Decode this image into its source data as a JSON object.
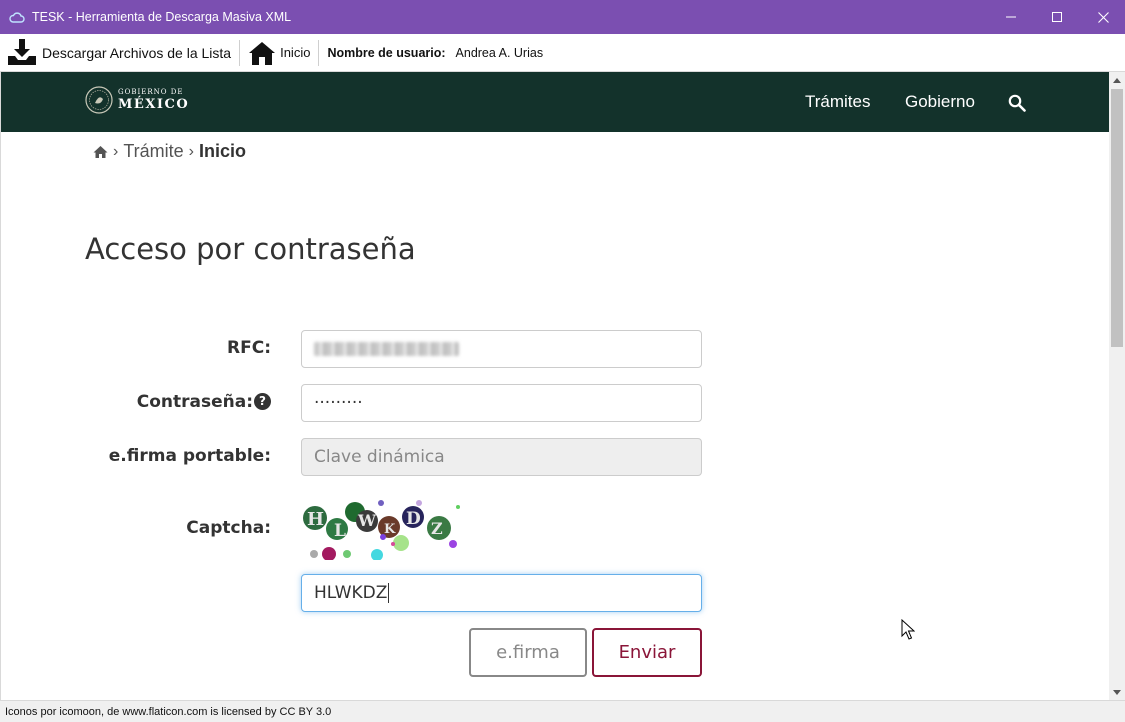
{
  "window": {
    "title": "TESK - Herramienta de Descarga Masiva XML",
    "app_icon": "cloud-icon",
    "controls": [
      "minimize-icon",
      "maximize-icon",
      "close-icon"
    ]
  },
  "toolbar": {
    "download_label": "Descargar Archivos de la Lista",
    "home_label": "Inicio",
    "user_label": "Nombre de usuario:",
    "user_name": "Andrea A. Urias"
  },
  "site_header": {
    "logo_line1": "GOBIERNO DE",
    "logo_line2": "MÉXICO",
    "nav": [
      "Trámites",
      "Gobierno"
    ],
    "search_icon": "search-icon",
    "background": "#13322b"
  },
  "breadcrumb": {
    "items": [
      "Trámite",
      "Inicio"
    ]
  },
  "form": {
    "title": "Acceso por contraseña",
    "rfc_label": "RFC:",
    "password_label": "Contraseña:",
    "password_value": "·········",
    "efirma_label": "e.firma portable:",
    "efirma_placeholder": "Clave dinámica",
    "captcha_label": "Captcha:",
    "captcha_text": "HLWKDZ",
    "captcha_input_value": "HLWKDZ",
    "efirma_button": "e.firma",
    "submit_button": "Enviar",
    "accent_color": "#8a1538"
  },
  "status_bar": {
    "text": "Iconos por icomoon, de www.flaticon.com is licensed by CC BY 3.0"
  }
}
